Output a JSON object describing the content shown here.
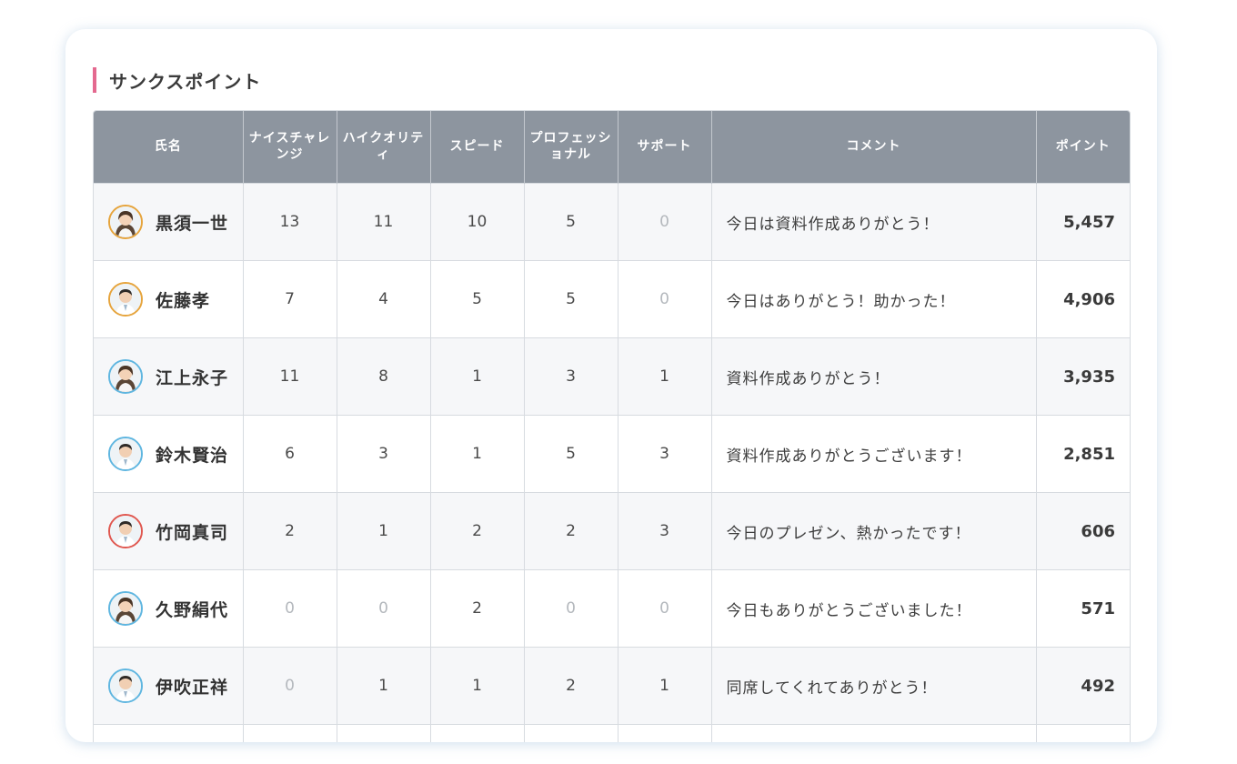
{
  "section": {
    "title": "サンクスポイント",
    "accent_color": "#e4698f"
  },
  "table": {
    "header_bg": "#8d959f",
    "columns": {
      "name": "氏名",
      "challenge": "ナイスチャレンジ",
      "quality": "ハイクオリティ",
      "speed": "スピード",
      "professional": "プロフェッショナル",
      "support": "サポート",
      "comment": "コメント",
      "points": "ポイント"
    },
    "rows": [
      {
        "name": "黒須一世",
        "avatar_icon": "avatar-woman-icon",
        "avatar_border": "#e6a43c",
        "challenge": "13",
        "quality": "11",
        "speed": "10",
        "professional": "5",
        "support": "0",
        "comment": "今日は資料作成ありがとう！",
        "points": "5,457"
      },
      {
        "name": "佐藤孝",
        "avatar_icon": "avatar-man-icon",
        "avatar_border": "#e6a43c",
        "challenge": "7",
        "quality": "4",
        "speed": "5",
        "professional": "5",
        "support": "0",
        "comment": "今日はありがとう！助かった！",
        "points": "4,906"
      },
      {
        "name": "江上永子",
        "avatar_icon": "avatar-woman-icon",
        "avatar_border": "#5fb6e0",
        "challenge": "11",
        "quality": "8",
        "speed": "1",
        "professional": "3",
        "support": "1",
        "comment": "資料作成ありがとう！",
        "points": "3,935"
      },
      {
        "name": "鈴木賢治",
        "avatar_icon": "avatar-man-icon",
        "avatar_border": "#5fb6e0",
        "challenge": "6",
        "quality": "3",
        "speed": "1",
        "professional": "5",
        "support": "3",
        "comment": "資料作成ありがとうございます！",
        "points": "2,851"
      },
      {
        "name": "竹岡真司",
        "avatar_icon": "avatar-man-icon",
        "avatar_border": "#e0574f",
        "challenge": "2",
        "quality": "1",
        "speed": "2",
        "professional": "2",
        "support": "3",
        "comment": "今日のプレゼン、熱かったです！",
        "points": "606"
      },
      {
        "name": "久野絹代",
        "avatar_icon": "avatar-woman-icon",
        "avatar_border": "#5fb6e0",
        "challenge": "0",
        "quality": "0",
        "speed": "2",
        "professional": "0",
        "support": "0",
        "comment": "今日もありがとうございました！",
        "points": "571"
      },
      {
        "name": "伊吹正祥",
        "avatar_icon": "avatar-man-icon",
        "avatar_border": "#5fb6e0",
        "challenge": "0",
        "quality": "1",
        "speed": "1",
        "professional": "2",
        "support": "1",
        "comment": "同席してくれてありがとう！",
        "points": "492"
      }
    ]
  }
}
